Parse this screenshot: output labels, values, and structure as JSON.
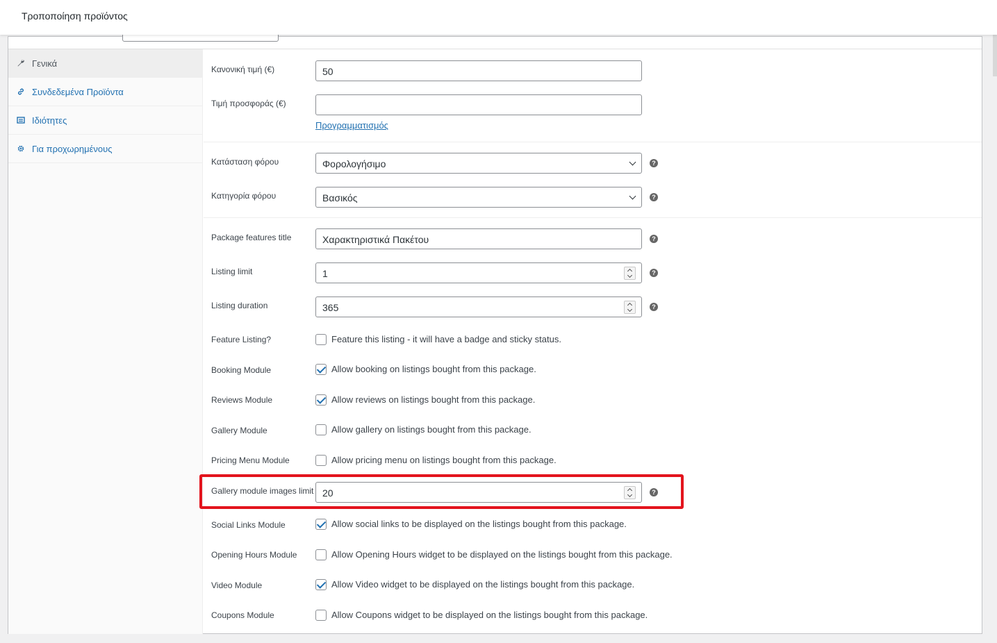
{
  "header": {
    "title": "Τροποποίηση προϊόντος"
  },
  "tabs": [
    {
      "label": "Γενικά",
      "icon": "wrench-icon"
    },
    {
      "label": "Συνδεδεμένα Προϊόντα",
      "icon": "link-icon"
    },
    {
      "label": "Ιδιότητες",
      "icon": "list-icon"
    },
    {
      "label": "Για προχωρημένους",
      "icon": "gear-icon"
    }
  ],
  "pricing": {
    "regular_label": "Κανονική τιμή (€)",
    "regular_value": "50",
    "sale_label": "Τιμή προσφοράς (€)",
    "sale_value": "",
    "schedule_link": "Προγραμματισμός"
  },
  "tax": {
    "status_label": "Κατάσταση φόρου",
    "status_value": "Φορολογήσιμο",
    "class_label": "Κατηγορία φόρου",
    "class_value": "Βασικός"
  },
  "package": {
    "features_title_label": "Package features title",
    "features_title_value": "Χαρακτηριστικά Πακέτου",
    "listing_limit_label": "Listing limit",
    "listing_limit_value": "1",
    "listing_duration_label": "Listing duration",
    "listing_duration_value": "365",
    "gallery_limit_label": "Gallery module images limit",
    "gallery_limit_value": "20"
  },
  "checkboxes": [
    {
      "label": "Feature Listing?",
      "text": "Feature this listing - it will have a badge and sticky status.",
      "checked": false
    },
    {
      "label": "Booking Module",
      "text": "Allow booking on listings bought from this package.",
      "checked": true
    },
    {
      "label": "Reviews Module",
      "text": "Allow reviews on listings bought from this package.",
      "checked": true
    },
    {
      "label": "Gallery Module",
      "text": "Allow gallery on listings bought from this package.",
      "checked": false
    },
    {
      "label": "Pricing Menu Module",
      "text": "Allow pricing menu on listings bought from this package.",
      "checked": false
    },
    {
      "label": "Social Links Module",
      "text": "Allow social links to be displayed on the listings bought from this package.",
      "checked": true
    },
    {
      "label": "Opening Hours Module",
      "text": "Allow Opening Hours widget to be displayed on the listings bought from this package.",
      "checked": false
    },
    {
      "label": "Video Module",
      "text": "Allow Video widget to be displayed on the listings bought from this package.",
      "checked": true
    },
    {
      "label": "Coupons Module",
      "text": "Allow Coupons widget to be displayed on the listings bought from this package.",
      "checked": false
    }
  ],
  "colors": {
    "highlight": "#e3141d",
    "link": "#2271b1"
  }
}
